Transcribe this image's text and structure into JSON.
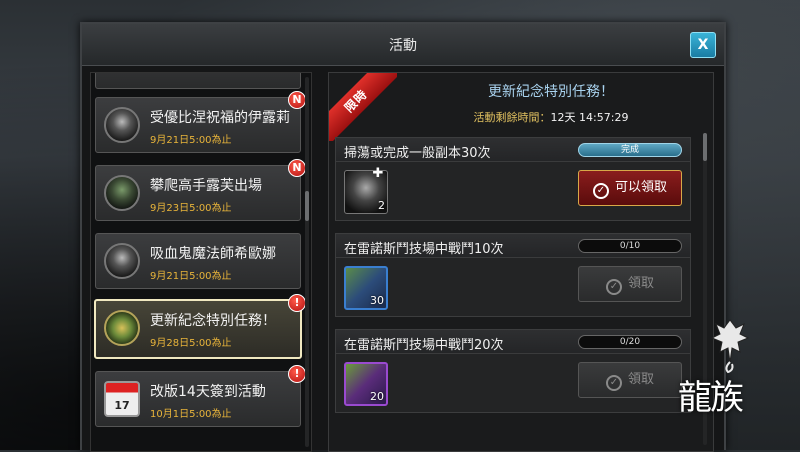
{
  "window": {
    "title": "活動",
    "close_label": "X"
  },
  "activity_list": [
    {
      "title": "受優比涅祝福的伊露莉",
      "date": "9月21日5:00為止",
      "badge": "N",
      "icon": "avatar-woman-icon"
    },
    {
      "title": "攀爬高手露芙出場",
      "date": "9月23日5:00為止",
      "badge": "N",
      "icon": "avatar-climber-icon"
    },
    {
      "title": "吸血鬼魔法師希歐娜",
      "date": "9月21日5:00為止",
      "badge": "",
      "icon": "avatar-vampire-icon"
    },
    {
      "title": "更新紀念特別任務！",
      "date": "9月28日5:00為止",
      "badge": "!",
      "icon": "trumpet-icon",
      "selected": true
    },
    {
      "title": "改版14天簽到活動",
      "date": "10月1日5:00為止",
      "badge": "!",
      "icon": "calendar-icon",
      "calendar_day": "17"
    }
  ],
  "detail": {
    "ribbon": "限時",
    "title": "更新紀念特別任務！",
    "timer_label": "活動剩餘時間：",
    "timer_value": "12天 14:57:29",
    "tasks": [
      {
        "title": "掃蕩或完成一般副本30次",
        "progress": "完成",
        "reward_count": "2",
        "button": "可以領取",
        "state": "active"
      },
      {
        "title": "在雷諾斯鬥技場中戰鬥10次",
        "progress": "0/10",
        "reward_count": "30",
        "button": "領取",
        "state": "disabled"
      },
      {
        "title": "在雷諾斯鬥技場中戰鬥20次",
        "progress": "0/20",
        "reward_count": "20",
        "button": "領取",
        "state": "disabled"
      }
    ]
  },
  "logo": {
    "text": "龍族"
  },
  "colors": {
    "accent_blue": "#a9d3ef",
    "date_gold": "#e8b43a",
    "badge_red": "#b31010",
    "ribbon_red": "#e0302a"
  }
}
